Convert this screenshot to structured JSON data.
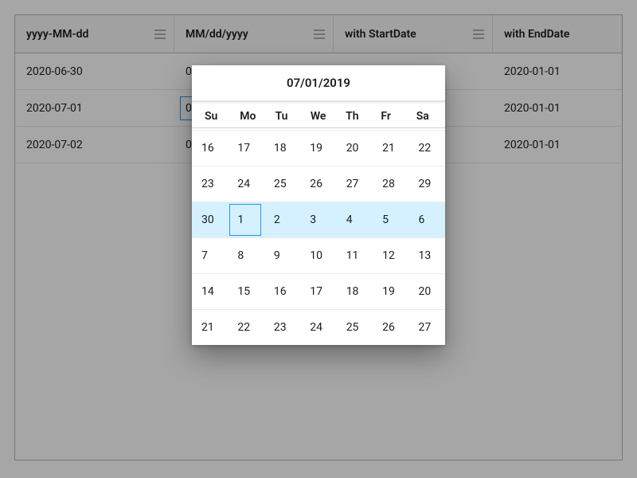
{
  "grid": {
    "columns": [
      {
        "header": "yyyy-MM-dd"
      },
      {
        "header": "MM/dd/yyyy"
      },
      {
        "header": "with StartDate"
      },
      {
        "header": "with EndDate"
      }
    ],
    "rows": [
      {
        "c0": "2020-06-30",
        "c1": "0",
        "c2": "",
        "c3": "2020-01-01"
      },
      {
        "c0": "2020-07-01",
        "c1": "0",
        "c2": "",
        "c3": "2020-01-01"
      },
      {
        "c0": "2020-07-02",
        "c1": "0",
        "c2": "",
        "c3": "2020-01-01"
      }
    ]
  },
  "datepicker": {
    "title": "07/01/2019",
    "weekdays": [
      "Su",
      "Mo",
      "Tu",
      "We",
      "Th",
      "Fr",
      "Sa"
    ],
    "weeks": [
      {
        "days": [
          "16",
          "17",
          "18",
          "19",
          "20",
          "21",
          "22"
        ],
        "highlight": false,
        "selected_index": -1
      },
      {
        "days": [
          "23",
          "24",
          "25",
          "26",
          "27",
          "28",
          "29"
        ],
        "highlight": false,
        "selected_index": -1
      },
      {
        "days": [
          "30",
          "1",
          "2",
          "3",
          "4",
          "5",
          "6"
        ],
        "highlight": true,
        "selected_index": 1
      },
      {
        "days": [
          "7",
          "8",
          "9",
          "10",
          "11",
          "12",
          "13"
        ],
        "highlight": false,
        "selected_index": -1
      },
      {
        "days": [
          "14",
          "15",
          "16",
          "17",
          "18",
          "19",
          "20"
        ],
        "highlight": false,
        "selected_index": -1
      },
      {
        "days": [
          "21",
          "22",
          "23",
          "24",
          "25",
          "26",
          "27"
        ],
        "highlight": false,
        "selected_index": -1
      }
    ]
  }
}
